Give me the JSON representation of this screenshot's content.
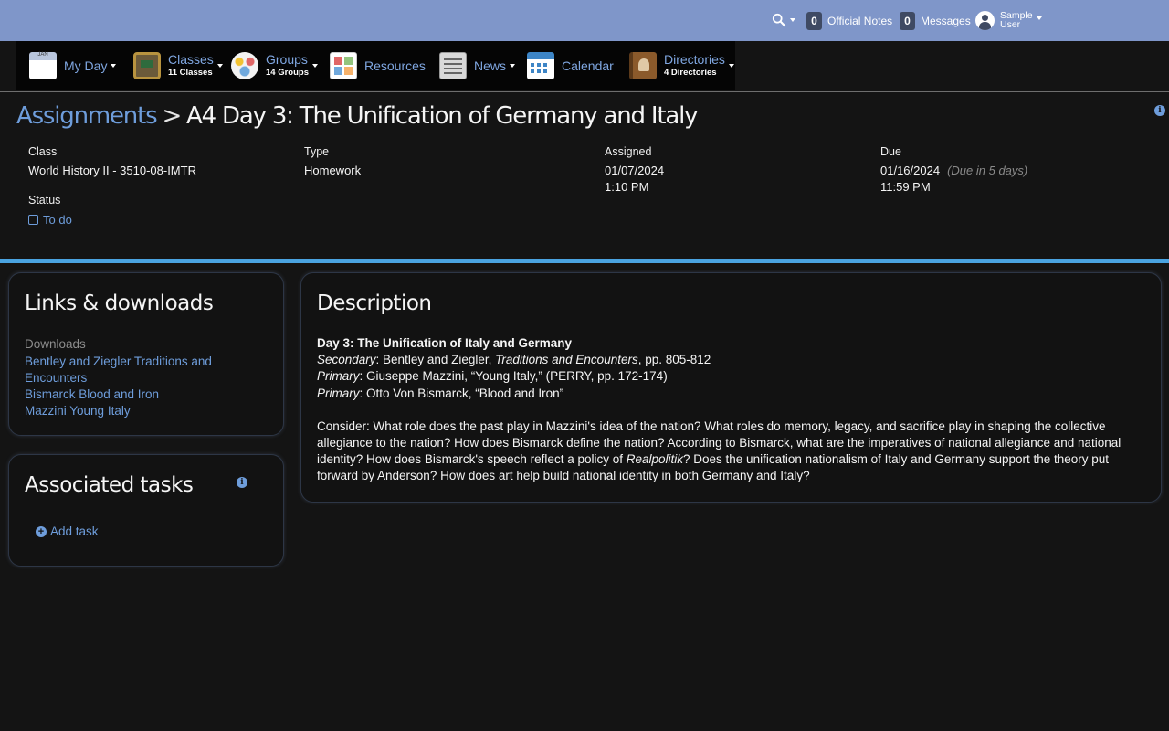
{
  "topbar": {
    "search_icon": "search-icon",
    "official_notes": {
      "count": "0",
      "label": "Official Notes"
    },
    "messages": {
      "count": "0",
      "label": "Messages"
    },
    "user": {
      "first": "Sample",
      "last": "User"
    }
  },
  "nav": {
    "myday": {
      "label": "My Day",
      "icon_text": "JAN"
    },
    "classes": {
      "label": "Classes",
      "sub": "11 Classes"
    },
    "groups": {
      "label": "Groups",
      "sub": "14 Groups"
    },
    "resources": {
      "label": "Resources"
    },
    "news": {
      "label": "News"
    },
    "calendar": {
      "label": "Calendar"
    },
    "directories": {
      "label": "Directories",
      "sub": "4 Directories"
    }
  },
  "header": {
    "breadcrumb_link": "Assignments",
    "separator": ">",
    "title": "A4 Day 3: The Unification of Germany and Italy"
  },
  "meta": {
    "class_label": "Class",
    "class_value": "World History II - 3510-08-IMTR",
    "type_label": "Type",
    "type_value": "Homework",
    "assigned_label": "Assigned",
    "assigned_date": "01/07/2024",
    "assigned_time": "1:10 PM",
    "due_label": "Due",
    "due_date": "01/16/2024",
    "due_note": "(Due in 5 days)",
    "due_time": "11:59 PM",
    "status_label": "Status",
    "status_value": "To do"
  },
  "links": {
    "title": "Links & downloads",
    "downloads_heading": "Downloads",
    "items": [
      "Bentley and Ziegler Traditions and Encounters",
      "Bismarck Blood and Iron",
      "Mazzini Young Italy"
    ]
  },
  "tasks": {
    "title": "Associated tasks",
    "add_label": "Add task"
  },
  "description": {
    "title": "Description",
    "heading": "Day 3: The Unification of Italy and Germany",
    "line1_label": "Secondary",
    "line1_pre": ": Bentley and Ziegler, ",
    "line1_italic": "Traditions and Encounters",
    "line1_post": ", pp. 805-812",
    "line2_label": "Primary",
    "line2_text": ": Giuseppe Mazzini, “Young Italy,” (PERRY, pp. 172-174)",
    "line3_label": "Primary",
    "line3_text": ": Otto Von Bismarck, “Blood and Iron”",
    "consider_pre": "Consider: What role does the past play in Mazzini's idea of the nation? What roles do memory, legacy, and sacrifice play in shaping the collective allegiance to the nation? How does Bismarck define the nation? According to Bismarck, what are the imperatives of national allegiance and national identity? How does Bismarck's speech reflect a policy of ",
    "consider_italic": "Realpolitik",
    "consider_post": "? Does the unification nationalism of Italy and Germany support the theory put forward by Anderson? How does art help build national identity in both Germany and Italy?"
  },
  "colors": {
    "topbar": "#7f96c9",
    "link": "#6e9ddb",
    "divider": "#4aa3e0",
    "background": "#141414"
  }
}
